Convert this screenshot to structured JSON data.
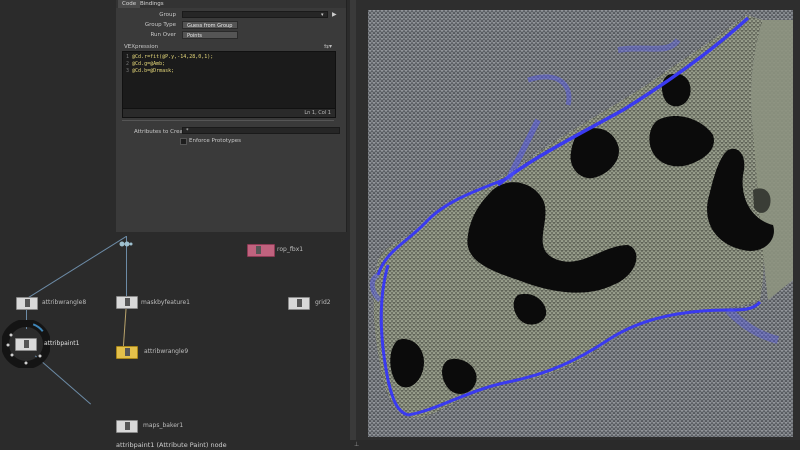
{
  "panel": {
    "tabs": [
      {
        "label": "Code"
      },
      {
        "label": "Bindings"
      }
    ],
    "group_label": "Group",
    "group_type_label": "Group Type",
    "group_type_value": "Guess from Group",
    "run_over_label": "Run Over",
    "run_over_value": "Points",
    "vexpression_label": "VEXpression",
    "code_lines": [
      {
        "num": "1",
        "text": "@Cd.r=fit(@P.y,-14,28,0,1);"
      },
      {
        "num": "2",
        "text": "@Cd.g=@Amb;"
      },
      {
        "num": "3",
        "text": "@Cd.b=@Drmask;"
      }
    ],
    "cursor_status": "Ln 1, Col 1",
    "attributes_to_create_label": "Attributes to Create",
    "attributes_to_create_value": "*",
    "enforce_prototypes_label": "Enforce Prototypes"
  },
  "network": {
    "nodes": [
      {
        "label": "attribwrangle8"
      },
      {
        "label": "maskbyfeature1"
      },
      {
        "label": "attribpaint1"
      },
      {
        "label": "attribwrangle9"
      },
      {
        "label": "rop_fbx1"
      },
      {
        "label": "grid2"
      },
      {
        "label": "maps_baker1"
      }
    ],
    "info": "attribpaint1 (Attribute Paint) node"
  },
  "colors": {
    "panel_bg": "#3a3a3a",
    "network_bg": "#2b2b2b",
    "selected_node": "#e3c04a",
    "rop_node": "#c0627e",
    "wire": "#6c8ba6",
    "mask_blue": "#3a3af0"
  },
  "icons": {
    "radial_menu": "radial-menu-icon",
    "pin": "pin-icon",
    "settings": "gear-icon"
  }
}
